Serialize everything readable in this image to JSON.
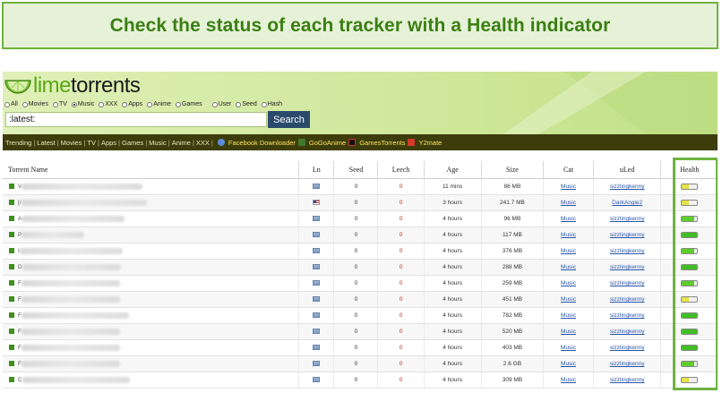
{
  "banner": {
    "text": "Check the status of each tracker with a Health indicator"
  },
  "logo": {
    "part1": "lime",
    "part2": "torrents"
  },
  "filters": [
    {
      "label": "All",
      "selected": false
    },
    {
      "label": "Movies",
      "selected": false
    },
    {
      "label": "TV",
      "selected": false
    },
    {
      "label": "Music",
      "selected": true
    },
    {
      "label": "XXX",
      "selected": false
    },
    {
      "label": "Apps",
      "selected": false
    },
    {
      "label": "Anime",
      "selected": false
    },
    {
      "label": "Games",
      "selected": false
    },
    {
      "label": "User",
      "selected": false
    },
    {
      "label": "Seed",
      "selected": false
    },
    {
      "label": "Hash",
      "selected": false
    }
  ],
  "search": {
    "value": ":latest:",
    "button": "Search"
  },
  "nav": {
    "items": [
      "Trending",
      "Latest",
      "Movies",
      "TV",
      "Apps",
      "Games",
      "Music",
      "Anime",
      "XXX"
    ],
    "external": [
      "Facebook Downloader",
      "GoGoAnime",
      "GamesTorrents",
      "Y2mate"
    ]
  },
  "table": {
    "headers": [
      "Torrent Name",
      "Ln",
      "Seed",
      "Leech",
      "Age",
      "Size",
      "Cat",
      "uLed",
      "Health"
    ],
    "rows": [
      {
        "initial": "V",
        "flag": "generic",
        "seed": "0",
        "leech": "0",
        "age": "11 mins",
        "size": "86 MB",
        "cat": "Music",
        "uploader": "sizzlingkenny",
        "health": 0.45,
        "health_color": "#e6e24a"
      },
      {
        "initial": "[/",
        "flag": "us",
        "seed": "0",
        "leech": "0",
        "age": "3 hours",
        "size": "241.7 MB",
        "cat": "Music",
        "uploader": "DarkAngie2",
        "health": 0.45,
        "health_color": "#e6e24a"
      },
      {
        "initial": "A",
        "flag": "generic",
        "seed": "0",
        "leech": "0",
        "age": "4 hours",
        "size": "96 MB",
        "cat": "Music",
        "uploader": "sizzlingkenny",
        "health": 0.8,
        "health_color": "#5ccf2a"
      },
      {
        "initial": "P",
        "flag": "generic",
        "seed": "0",
        "leech": "0",
        "age": "4 hours",
        "size": "117 MB",
        "cat": "Music",
        "uploader": "sizzlingkenny",
        "health": 1.0,
        "health_color": "#3fbf24"
      },
      {
        "initial": "I",
        "flag": "generic",
        "seed": "0",
        "leech": "0",
        "age": "4 hours",
        "size": "376 MB",
        "cat": "Music",
        "uploader": "sizzlingkenny",
        "health": 0.8,
        "health_color": "#5ccf2a"
      },
      {
        "initial": "D",
        "flag": "generic",
        "seed": "0",
        "leech": "0",
        "age": "4 hours",
        "size": "288 MB",
        "cat": "Music",
        "uploader": "sizzlingkenny",
        "health": 1.0,
        "health_color": "#3fbf24"
      },
      {
        "initial": "F",
        "flag": "generic",
        "seed": "0",
        "leech": "0",
        "age": "4 hours",
        "size": "259 MB",
        "cat": "Music",
        "uploader": "sizzlingkenny",
        "health": 0.8,
        "health_color": "#5ccf2a"
      },
      {
        "initial": "F",
        "flag": "generic",
        "seed": "0",
        "leech": "0",
        "age": "4 hours",
        "size": "451 MB",
        "cat": "Music",
        "uploader": "sizzlingkenny",
        "health": 0.45,
        "health_color": "#e6e24a"
      },
      {
        "initial": "F",
        "flag": "generic",
        "seed": "0",
        "leech": "0",
        "age": "4 hours",
        "size": "782 MB",
        "cat": "Music",
        "uploader": "sizzlingkenny",
        "health": 1.0,
        "health_color": "#3fbf24"
      },
      {
        "initial": "F",
        "flag": "generic",
        "seed": "0",
        "leech": "0",
        "age": "4 hours",
        "size": "520 MB",
        "cat": "Music",
        "uploader": "sizzlingkenny",
        "health": 1.0,
        "health_color": "#3fbf24"
      },
      {
        "initial": "F",
        "flag": "generic",
        "seed": "0",
        "leech": "0",
        "age": "4 hours",
        "size": "403 MB",
        "cat": "Music",
        "uploader": "sizzlingkenny",
        "health": 1.0,
        "health_color": "#3fbf24"
      },
      {
        "initial": "F",
        "flag": "generic",
        "seed": "0",
        "leech": "0",
        "age": "4 hours",
        "size": "2.6 GB",
        "cat": "Music",
        "uploader": "sizzlingkenny",
        "health": 0.8,
        "health_color": "#5ccf2a"
      },
      {
        "initial": "C",
        "flag": "generic",
        "seed": "0",
        "leech": "0",
        "age": "4 hours",
        "size": "309 MB",
        "cat": "Music",
        "uploader": "sizzlingkenny",
        "health": 0.45,
        "health_color": "#e6e24a"
      }
    ]
  },
  "colors": {
    "accent_green": "#6db33f",
    "nav_bg": "#3d3d0c",
    "search_btn": "#2b4a6b",
    "link": "#2a55aa"
  }
}
